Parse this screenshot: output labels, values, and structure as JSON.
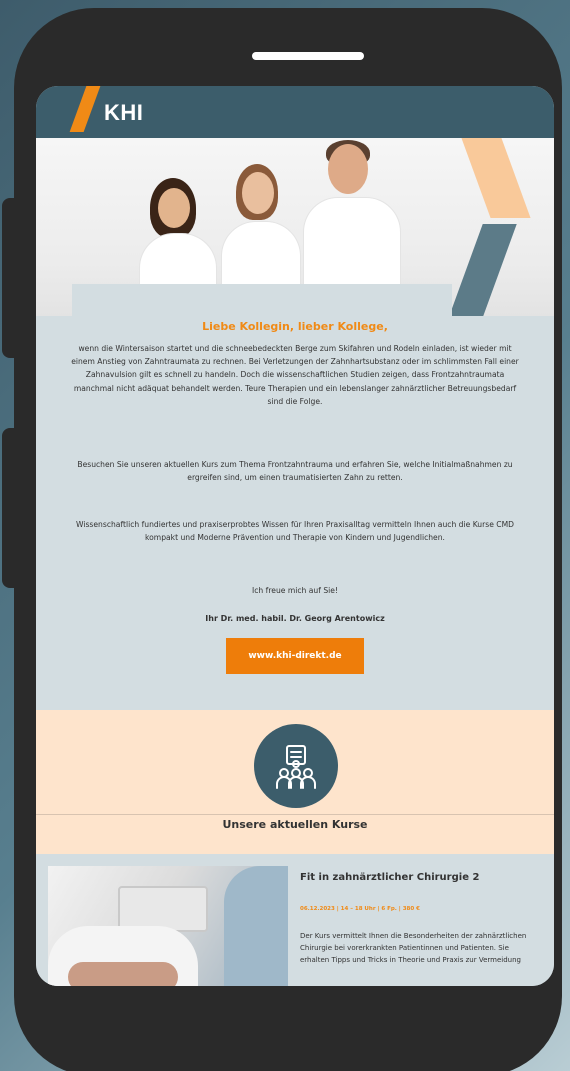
{
  "header": {
    "logo_text": "KHI",
    "accent_color": "#f08a16",
    "header_color": "#3c5d6b"
  },
  "letter": {
    "greeting": "Liebe Kollegin, lieber Kollege,",
    "paragraph1": "wenn die Wintersaison startet und die schneebedeckten Berge zum Skifahren und Rodeln einladen, ist wieder mit einem Anstieg von Zahntraumata zu rechnen. Bei Verletzungen der Zahnhartsubstanz oder im schlimmsten Fall einer Zahnavulsion gilt es schnell zu handeln. Doch die wissenschaftlichen Studien zeigen, dass Frontzahntraumata manchmal nicht adäquat behandelt werden. Teure Therapien und ein lebenslanger zahnärztlicher Betreuungsbedarf sind die Folge.",
    "paragraph2": "Besuchen Sie unseren aktuellen Kurs zum Thema Frontzahntrauma und erfahren Sie, welche Initialmaßnahmen zu ergreifen sind, um einen traumatisierten Zahn zu retten.",
    "paragraph3": "Wissenschaftlich fundiertes und praxiserprobtes Wissen für Ihren Praxisalltag vermitteln Ihnen auch die Kurse CMD kompakt und Moderne Prävention und Therapie von Kindern und Jugendlichen.",
    "paragraph4": "Ich freue mich auf Sie!",
    "signature": "Ihr Dr. med. habil. Dr. Georg Arentowicz",
    "cta_label": "www.khi-direkt.de"
  },
  "courses": {
    "section_title": "Unsere aktuellen Kurse",
    "icon": "people-group-icon",
    "items": [
      {
        "title": "Fit in zahnärztlicher Chirurgie 2",
        "meta": "06.12.2023 | 14 – 18 Uhr | 6 Fp. | 380 €",
        "description": "Der Kurs vermittelt Ihnen die Besonderheiten der zahnärztlichen Chirurgie bei vorerkrankten Patientinnen und Patienten. Sie erhalten Tipps und Tricks in Theorie und Praxis zur Vermeidung"
      }
    ]
  }
}
